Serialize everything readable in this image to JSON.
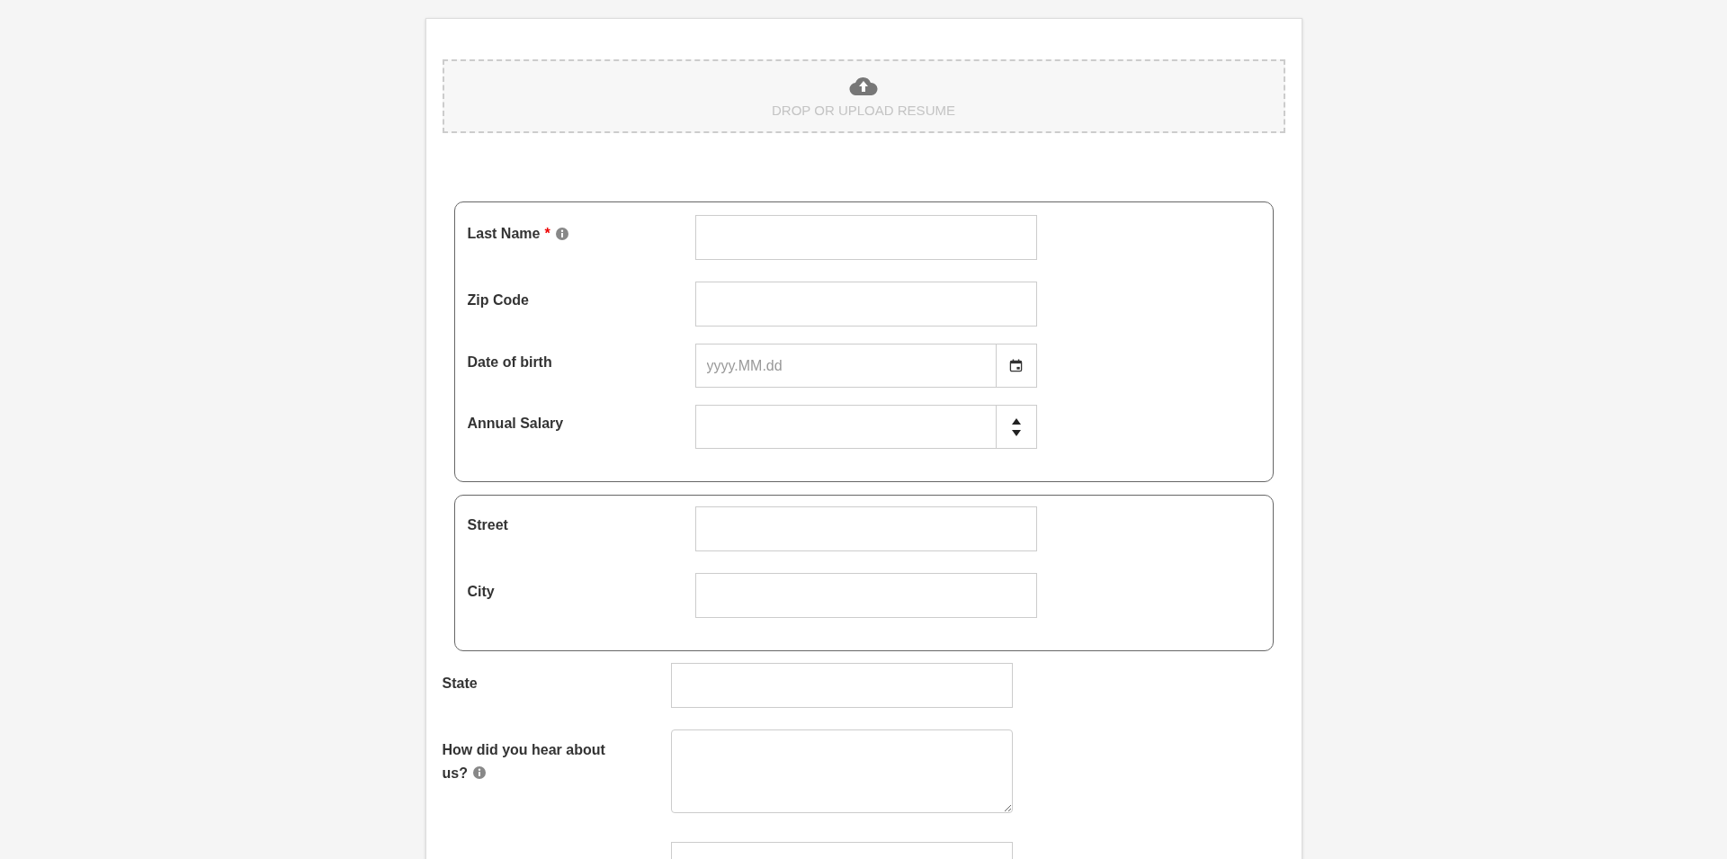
{
  "upload": {
    "label": "DROP OR UPLOAD RESUME"
  },
  "groups": [
    {
      "fields": [
        {
          "kind": "text",
          "label": "Last Name",
          "asterisk": "*",
          "info": true
        },
        {
          "kind": "text",
          "label": "Zip Code",
          "info": false
        },
        {
          "kind": "date",
          "label": "Date of birth",
          "info": false,
          "placeholder": "yyyy.MM.dd"
        },
        {
          "kind": "number",
          "label": "Annual Salary",
          "info": false
        }
      ]
    },
    {
      "fields": [
        {
          "kind": "text",
          "label": "Street",
          "info": false
        },
        {
          "kind": "text",
          "label": "City",
          "info": false
        }
      ]
    }
  ],
  "fields": [
    {
      "kind": "text",
      "label": "State",
      "info": false
    },
    {
      "kind": "textarea",
      "label": "How did you hear about us?",
      "info": true
    },
    {
      "kind": "text",
      "info": false
    }
  ]
}
